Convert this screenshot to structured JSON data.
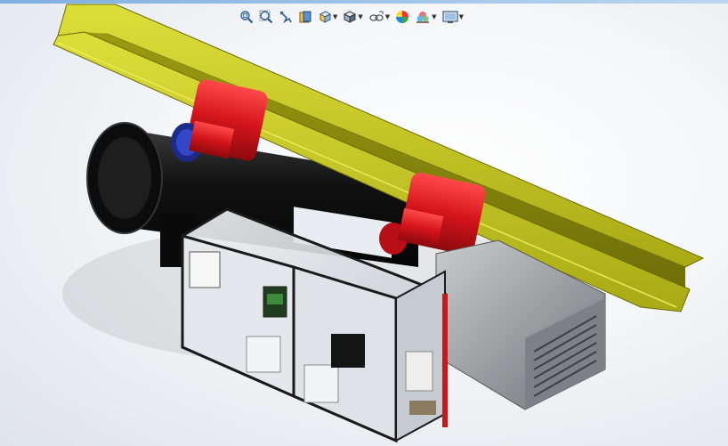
{
  "app": {
    "name": "3D CAD viewport"
  },
  "heads_up_toolbar": {
    "items": [
      {
        "id": "zoom-to-fit",
        "icon": "zoom-to-fit-icon",
        "has_dropdown": false
      },
      {
        "id": "zoom-to-area",
        "icon": "zoom-to-area-icon",
        "has_dropdown": false
      },
      {
        "id": "previous-view",
        "icon": "previous-view-icon",
        "has_dropdown": false
      },
      {
        "id": "section-view",
        "icon": "section-view-icon",
        "has_dropdown": false
      },
      {
        "id": "view-orientation",
        "icon": "view-orientation-icon",
        "has_dropdown": true
      },
      {
        "id": "display-style",
        "icon": "display-style-icon",
        "has_dropdown": true
      },
      {
        "id": "hide-show-items",
        "icon": "hide-show-items-icon",
        "has_dropdown": true
      },
      {
        "id": "edit-appearance",
        "icon": "edit-appearance-icon",
        "has_dropdown": false
      },
      {
        "id": "apply-scene",
        "icon": "apply-scene-icon",
        "has_dropdown": true
      },
      {
        "id": "view-settings",
        "icon": "view-settings-icon",
        "has_dropdown": true
      }
    ],
    "dropdown_glyph": "▼"
  },
  "model": {
    "description_colors": {
      "beam": "#b7b81a",
      "hoist": "#d3141b",
      "motor": "#141414",
      "enclosure_frame": "#1a1a1a",
      "transformer": "#8a8d90",
      "panel_glass": "#d8dde2"
    }
  }
}
